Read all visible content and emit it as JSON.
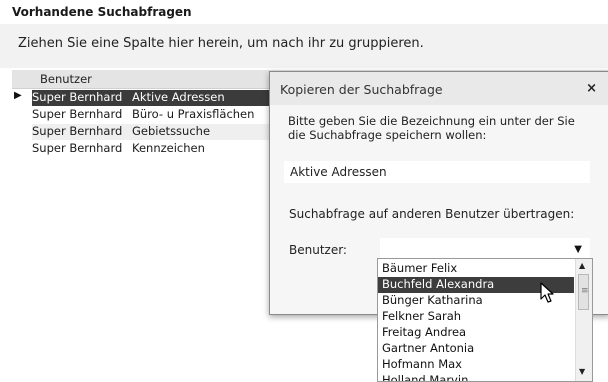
{
  "section_title": "Vorhandene Suchabfragen",
  "group_hint": "Ziehen Sie eine Spalte hier herein, um nach ihr zu gruppieren.",
  "grid": {
    "column_header": "Benutzer",
    "rows": [
      {
        "user": "Super Bernhard",
        "query": "Aktive Adressen",
        "selected": true
      },
      {
        "user": "Super Bernhard",
        "query": "Büro- u Praxisflächen"
      },
      {
        "user": "Super Bernhard",
        "query": "Gebietssuche"
      },
      {
        "user": "Super Bernhard",
        "query": "Kennzeichen"
      }
    ],
    "row_indicator": "▶"
  },
  "dialog": {
    "title": "Kopieren der Suchabfrage",
    "close": "×",
    "prompt": "Bitte geben Sie die Bezeichnung ein unter der Sie die Suchabfrage speichern wollen:",
    "name_value": "Aktive Adressen",
    "transfer_label": "Suchabfrage auf anderen Benutzer übertragen:",
    "user_label": "Benutzer:",
    "user_value": "",
    "dropdown_arrow": "▼"
  },
  "dropdown": {
    "options": [
      "Bäumer Felix",
      "Buchfeld Alexandra",
      "Bünger Katharina",
      "Felkner Sarah",
      "Freitag Andrea",
      "Gartner Antonia",
      "Hofmann Max",
      "Holland Marvin"
    ],
    "highlighted_index": 1,
    "scroll_up": "▲",
    "scroll_down": "▼",
    "scroll_grip": "≡"
  },
  "icons": [
    "row-indicator-icon",
    "close-icon",
    "chevron-down-icon",
    "scroll-up-icon",
    "scroll-down-icon",
    "mouse-cursor-icon"
  ]
}
